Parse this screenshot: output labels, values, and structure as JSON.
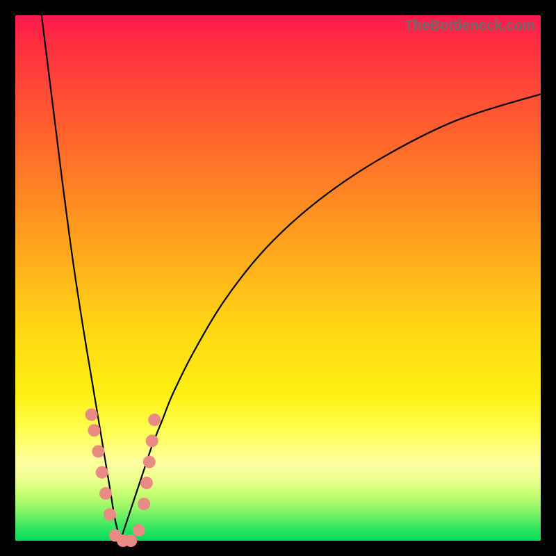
{
  "watermark": "TheBottleneck.com",
  "colors": {
    "frame": "#000000",
    "curve": "#000000",
    "dot_fill": "#e98a84",
    "dot_stroke": "#e98a84"
  },
  "chart_data": {
    "type": "line",
    "title": "",
    "xlabel": "",
    "ylabel": "",
    "xlim": [
      0,
      100
    ],
    "ylim": [
      0,
      100
    ],
    "note": "V-shaped bottleneck curve; y is bottleneck percentage (100 at top, 0 at bottom). Minimum near x≈20 where curve touches 0 (green). Left branch rises steeply from x≈5 (y≈100) down to the minimum; right branch rises gradually toward x=100 (y≈85). Pink dots cluster on both branches near the bottom.",
    "series": [
      {
        "name": "left-branch",
        "x": [
          5,
          7,
          9,
          11,
          13,
          15,
          16,
          17,
          18,
          19,
          20
        ],
        "y": [
          100,
          84,
          68,
          53,
          40,
          28,
          22,
          16,
          10,
          4,
          0
        ]
      },
      {
        "name": "right-branch",
        "x": [
          20,
          22,
          24,
          26,
          28,
          30,
          34,
          40,
          48,
          58,
          70,
          84,
          100
        ],
        "y": [
          0,
          6,
          12,
          18,
          23,
          28,
          36,
          46,
          56,
          65,
          73,
          80,
          85
        ]
      }
    ],
    "dots": {
      "name": "highlighted-points",
      "points": [
        {
          "x": 14.5,
          "y": 24
        },
        {
          "x": 15.0,
          "y": 21
        },
        {
          "x": 15.8,
          "y": 17
        },
        {
          "x": 16.5,
          "y": 13
        },
        {
          "x": 17.2,
          "y": 9
        },
        {
          "x": 18.0,
          "y": 5
        },
        {
          "x": 19.0,
          "y": 1
        },
        {
          "x": 20.5,
          "y": 0
        },
        {
          "x": 22.0,
          "y": 0
        },
        {
          "x": 23.5,
          "y": 2
        },
        {
          "x": 24.5,
          "y": 7
        },
        {
          "x": 25.0,
          "y": 11
        },
        {
          "x": 25.5,
          "y": 15
        },
        {
          "x": 26.0,
          "y": 19
        },
        {
          "x": 26.5,
          "y": 23
        }
      ]
    }
  }
}
